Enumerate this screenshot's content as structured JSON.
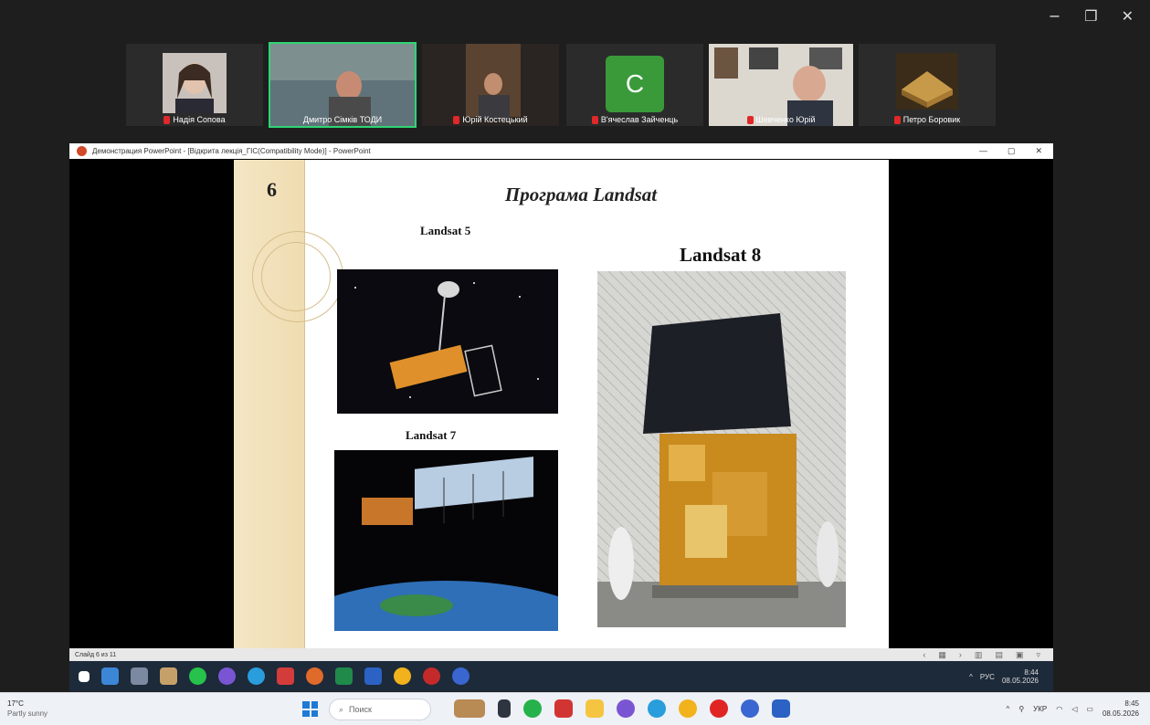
{
  "meeting": {
    "window_controls": [
      "−",
      "❐",
      "✕"
    ],
    "participants": [
      {
        "name": "Надія Сопова",
        "avatar_letter": "",
        "color": "#7a6a60",
        "active": false
      },
      {
        "name": "Дмитро Сімків ТОДИ",
        "avatar_letter": "",
        "color": "#5a6b6e",
        "active": true
      },
      {
        "name": "Юрій Костецький",
        "avatar_letter": "",
        "color": "#4b4035",
        "active": false
      },
      {
        "name": "В'ячеслав Зайченць",
        "avatar_letter": "C",
        "color": "#3a9a3a",
        "active": false
      },
      {
        "name": "Шевченко Юрій",
        "avatar_letter": "",
        "color": "#d9d6cf",
        "active": false
      },
      {
        "name": "Петро Боровик",
        "avatar_letter": "",
        "color": "#8a6a3a",
        "active": false
      }
    ]
  },
  "ppt": {
    "title": "Демонстрация PowerPoint - [Відкрита лекція_ГІС(Compatibility Mode)] - PowerPoint",
    "window_controls": [
      "—",
      "▢",
      "✕"
    ],
    "status_left": "Слайд 6 из 11",
    "slide": {
      "number": "6",
      "title": "Програма Landsat",
      "caption_l5": "Landsat 5",
      "caption_l7": "Landsat 7",
      "caption_l8": "Landsat 8"
    },
    "inner_tray": {
      "lang": "РУС",
      "time": "8:44",
      "date": "08.05.2026"
    }
  },
  "taskbar": {
    "weather_temp": "17°C",
    "weather_desc": "Partly sunny",
    "search_placeholder": "Поиск",
    "lang": "УКР",
    "time": "8:45",
    "date": "08.05.2026"
  },
  "colors": {
    "slide_band": "#f1e0b8",
    "active_speaker": "#2ed573",
    "mic_muted": "#e02828"
  }
}
